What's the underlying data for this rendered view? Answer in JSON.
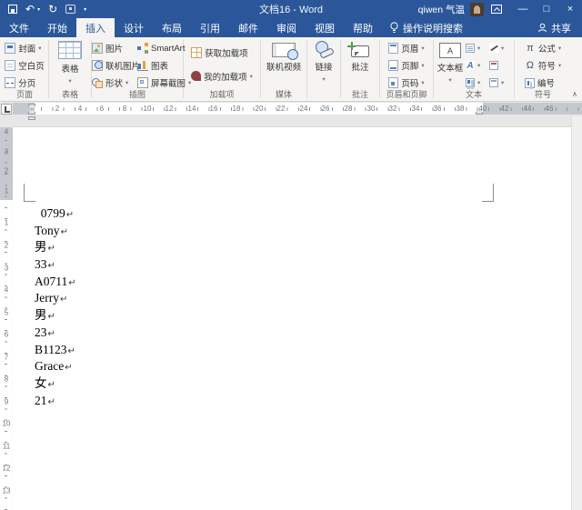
{
  "titlebar": {
    "title": "文档16 - Word",
    "user": "qiwen 气温"
  },
  "window_controls": {
    "minimize": "—",
    "maximize": "□",
    "close": "×"
  },
  "glyphs": {
    "undo": "↶",
    "redo": "↻",
    "dropdown": "▾",
    "collapse": "∧",
    "pi": "π",
    "omega": "Ω",
    "pilcrow": "↵",
    "textbox_letter": "A",
    "wordart_letter": "A"
  },
  "tabs": [
    {
      "label": "文件"
    },
    {
      "label": "开始"
    },
    {
      "label": "插入"
    },
    {
      "label": "设计"
    },
    {
      "label": "布局"
    },
    {
      "label": "引用"
    },
    {
      "label": "邮件"
    },
    {
      "label": "审阅"
    },
    {
      "label": "视图"
    },
    {
      "label": "帮助"
    }
  ],
  "tellme_label": "操作说明搜索",
  "share_label": "共享",
  "ribbon": {
    "pages": {
      "group": "页面",
      "cover": "封面",
      "blank": "空白页",
      "pagebreak": "分页"
    },
    "tables": {
      "group": "表格",
      "table": "表格"
    },
    "illustrations": {
      "group": "插图",
      "picture": "图片",
      "online_picture": "联机图片",
      "shapes": "形状",
      "smartart": "SmartArt",
      "chart": "图表",
      "screenshot": "屏幕截图"
    },
    "addins": {
      "group": "加载项",
      "get_addins": "获取加载项",
      "my_addins": "我的加载项"
    },
    "media": {
      "group": "媒体",
      "online_video": "联机视频"
    },
    "links": {
      "link": "链接"
    },
    "comments": {
      "group": "批注",
      "comment": "批注"
    },
    "header_footer": {
      "group": "页眉和页脚",
      "header": "页眉",
      "footer": "页脚",
      "page_number": "页码"
    },
    "text": {
      "group": "文本",
      "textbox": "文本框"
    },
    "symbols": {
      "group": "符号",
      "equation": "公式",
      "symbol": "符号",
      "number": "编号"
    }
  },
  "ruler": {
    "h_numbers": [
      2,
      4,
      6,
      8,
      10,
      12,
      14,
      16,
      18,
      20,
      22,
      24,
      26,
      28,
      30,
      32,
      34,
      36,
      38,
      40,
      42,
      44,
      46
    ],
    "v_margin_numbers": [
      4,
      3,
      2,
      1
    ],
    "v_numbers": [
      1,
      2,
      3,
      4,
      5,
      6,
      7,
      8,
      9,
      10,
      11,
      12,
      13
    ]
  },
  "document": {
    "lines": [
      "  0799",
      "Tony",
      "男",
      "33",
      "A0711",
      "Jerry",
      "男",
      "23",
      "B1123",
      "Grace",
      "女",
      "21"
    ]
  },
  "colors": {
    "accent": "#2b579a"
  }
}
